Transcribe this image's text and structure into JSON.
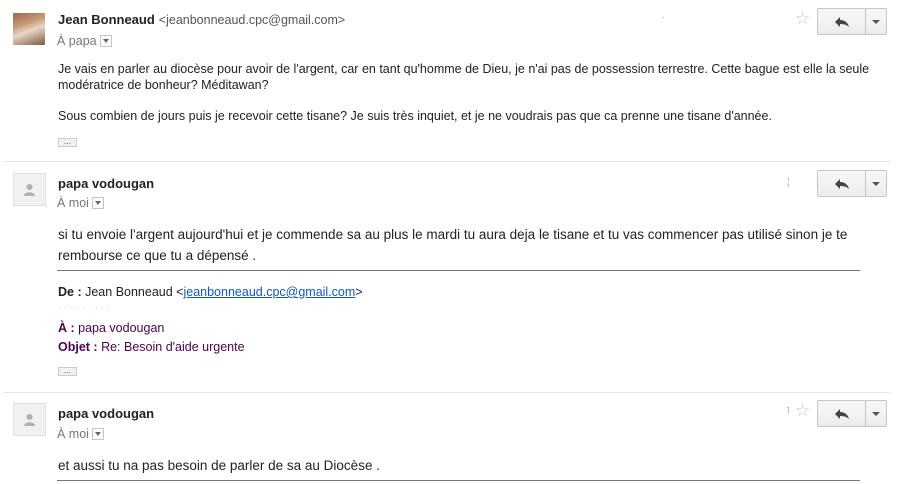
{
  "messages": [
    {
      "sender": "Jean Bonneaud",
      "email": "<jeanbonneaud.cpc@gmail.com>",
      "recipient": "À papa",
      "paragraphs": [
        "Je vais en parler au diocèse pour avoir de l'argent, car en tant qu'homme de Dieu, je n'ai pas de possession terrestre. Cette bague est elle la seule modératrice de bonheur? Méditawan?",
        "Sous combien de jours puis je recevoir cette tisane? Je suis très inquiet, et je ne voudrais pas que ca prenne une tisane d'année."
      ],
      "ellipsis": "..."
    },
    {
      "sender": "papa vodougan",
      "recipient": "À moi",
      "body": "si tu envoie l'argent aujourd'hui et je commende sa au plus le mardi tu aura deja le tisane et tu vas commencer pas utilisé sinon je te rembourse ce que tu a dépensé .",
      "quote": {
        "from_label": "De :",
        "from_name": "Jean Bonneaud <",
        "from_email": "jeanbonneaud.cpc@gmail.com",
        "from_close": ">",
        "to_label": "À :",
        "to_value": "papa vodougan",
        "subject_label": "Objet :",
        "subject_value": "Re: Besoin d'aide urgente"
      },
      "ellipsis": "..."
    },
    {
      "sender": "papa vodougan",
      "recipient": "À moi",
      "body": "et aussi tu na pas besoin de parler de sa au Diocèse ."
    }
  ],
  "icons": {
    "star": "☆",
    "reply": "reply-arrow-icon",
    "more": "chevron-down-icon"
  }
}
